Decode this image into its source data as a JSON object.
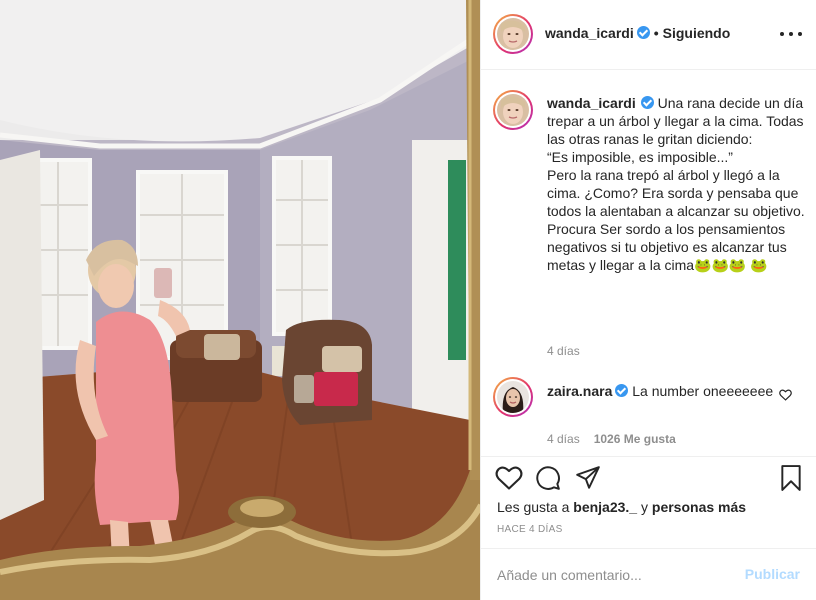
{
  "post": {
    "author": {
      "username": "wanda_icardi",
      "verified": true,
      "follow_status": "Siguiendo",
      "separator": "•"
    },
    "photo": {
      "description_icon": "mirror-selfie-photo"
    },
    "caption": {
      "username": "wanda_icardi",
      "text": "Una rana decide un día trepar a un árbol y llegar a la cima. Todas las otras ranas le gritan diciendo:\n“Es imposible, es imposible...”\nPero la rana trepó al árbol y llegó a la cima. ¿Como? Era sorda y pensaba que todos la alentaban a alcanzar su objetivo.\nProcura Ser sordo a los pensamientos negativos si tu objetivo es alcanzar tus metas y llegar a la cima🐸🐸🐸 🐸",
      "time": "4 días"
    },
    "comments": [
      {
        "username": "zaira.nara",
        "verified": true,
        "text": "La number oneeeeeee",
        "time": "4 días",
        "likes": "1026 Me gusta"
      }
    ],
    "actions": {
      "like_icon": "heart-icon",
      "comment_icon": "comment-icon",
      "share_icon": "share-icon",
      "save_icon": "bookmark-icon"
    },
    "likes": {
      "prefix": "Les gusta a",
      "user": "benja23._",
      "connector": "y",
      "rest": "personas más"
    },
    "date": "HACE 4 DÍAS",
    "add_comment": {
      "placeholder": "Añade un comentario...",
      "publish_label": "Publicar"
    }
  },
  "colors": {
    "verified": "#3897f0",
    "text": "#262626",
    "muted": "#8e8e8e",
    "publish_disabled": "#b3dbff",
    "story_ring_start": "#f5b942",
    "story_ring_end": "#b02fbf"
  }
}
